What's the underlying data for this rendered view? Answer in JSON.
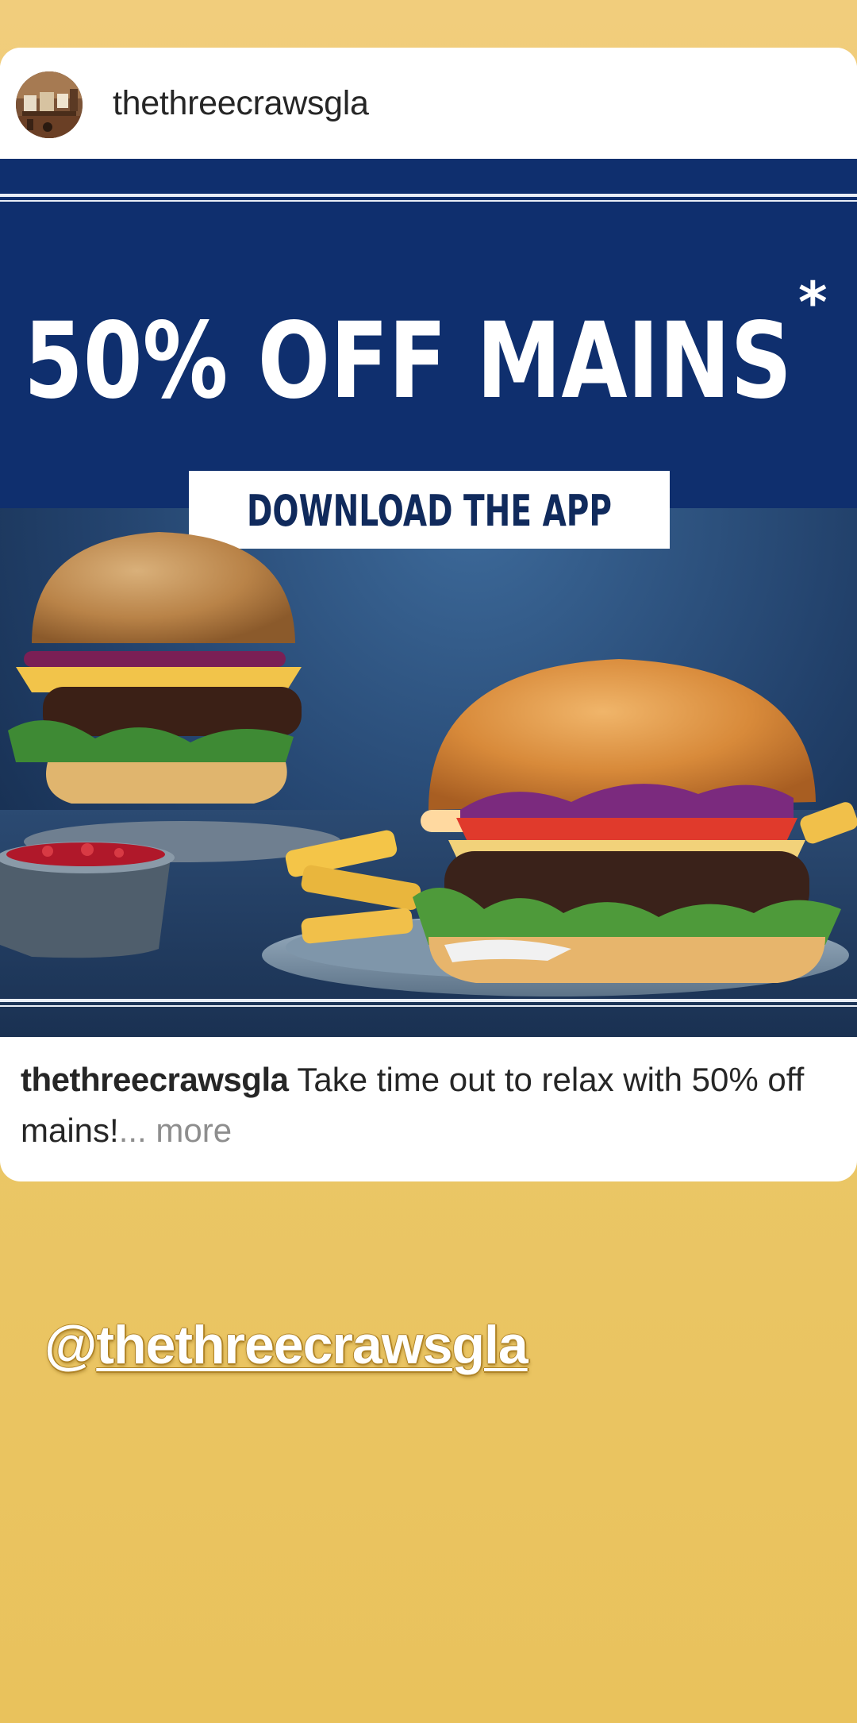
{
  "post": {
    "username": "thethreecrawsgla",
    "image": {
      "headline": "50% OFF MAINS",
      "headline_mark": "*",
      "cta": "DOWNLOAD THE APP"
    },
    "caption": {
      "username": "thethreecrawsgla",
      "text": "Take time out to relax with 50% off mains!",
      "ellipsis": "...",
      "more": "more"
    }
  },
  "story": {
    "mention_prefix": "@",
    "mention_handle": "thethreecrawsgla"
  },
  "colors": {
    "story_background": "#ecc76a",
    "banner_blue": "#0f2f6e",
    "card_background": "#ffffff",
    "caption_text": "#262626",
    "more_text": "#8e8e8e"
  },
  "icons": {
    "avatar": "profile-avatar-photo"
  }
}
